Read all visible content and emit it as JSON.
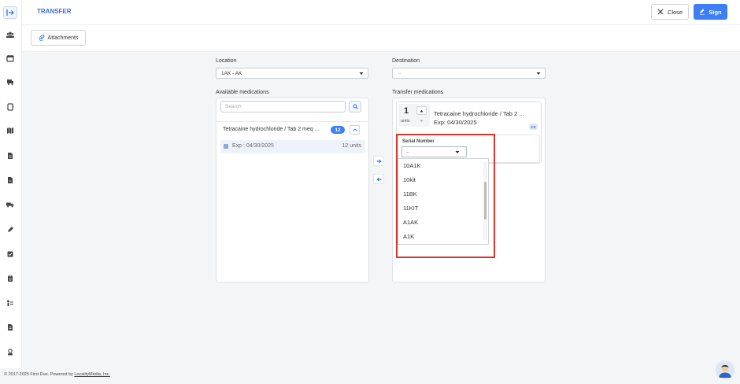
{
  "header": {
    "tab_label": "TRANSFER",
    "close_label": "Close",
    "sign_label": "Sign"
  },
  "toolbar": {
    "attachments_label": "Attachments"
  },
  "form": {
    "location_label": "Location",
    "location_value": "1AK - AK",
    "destination_label": "Destination",
    "destination_value": "--",
    "available_label": "Available medications",
    "transfer_label": "Transfer medications"
  },
  "available": {
    "search_placeholder": "Search",
    "medication_name": "Tetracaine hydrochloride / Tab 2 meq ...",
    "count_badge": "12",
    "lot_expiration": "Exp : 04/30/2025",
    "lot_units": "12 units"
  },
  "transfer_card": {
    "quantity": "1",
    "quantity_unit": "units",
    "medication_name": "Tetracaine hydrochloride / Tab 2 ...",
    "expiration": "Exp: 04/30/2025",
    "schedule_badge": "CS",
    "serial_label": "Serial Number",
    "serial_value": "--"
  },
  "serial_options": [
    "10A1K",
    "10kit",
    "11BK",
    "11KIT",
    "A1AK",
    "A1K"
  ],
  "footer": {
    "copyright_prefix": "© 2017-2025 First Due. Powered by ",
    "copyright_link": "LocalityMedia, Inc."
  },
  "colors": {
    "accent": "#3b7ef5",
    "highlight": "#e0342a"
  }
}
